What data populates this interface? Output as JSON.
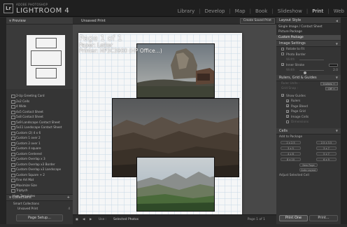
{
  "app": {
    "brand_small": "ADOBE PHOTOSHOP",
    "brand": "LIGHTROOM 4",
    "logo": "Lr"
  },
  "modules": [
    "Library",
    "Develop",
    "Map",
    "Book",
    "Slideshow",
    "Print",
    "Web"
  ],
  "active_module": "Print",
  "left_panel": {
    "preview_title": "Preview",
    "templates": [
      "2-Up Greeting Card",
      "2x2 Cells",
      "4 Wide",
      "4x5 Contact Sheet",
      "5x8 Contact Sheet",
      "5x9 Landscape Contact Sheet",
      "5x11 Landscape Contact Sheet",
      "Custom (2) 4 x 6",
      "Custom 1 over 2",
      "Custom 2 over 1",
      "Custom 4 square",
      "Custom Centered",
      "Custom Overlap x 3",
      "Custom Overlap x3 Border",
      "Custom Overlap x3 Landscape",
      "Custom Square + 2",
      "Fine Art Mat",
      "Maximize Size",
      "Triptych"
    ],
    "user_templates": "User Templates",
    "collections_title": "Collections",
    "collections": [
      {
        "name": "Smart Collections",
        "count": ""
      },
      {
        "name": "Unsaved Print",
        "count": "4"
      }
    ],
    "page_setup_label": "Page Setup..."
  },
  "center": {
    "title": "Unsaved Print",
    "create_saved_label": "Create Saved Print",
    "page_info": {
      "page": "Page 1 of 1",
      "paper": "Paper: Letter",
      "printer": "Printer: HP3C3900 (HP Office...)"
    },
    "footer": {
      "use_label": "Use :",
      "use_value": "Selected Photos",
      "page_count": "Page 1 of 1"
    }
  },
  "right_panel": {
    "layout_style_title": "Layout Style",
    "layout_styles": [
      "Single Image / Contact Sheet",
      "Picture Package",
      "Custom Package"
    ],
    "selected_style": "Custom Package",
    "image_settings_title": "Image Settings",
    "rotate_to_fit": "Rotate to Fit",
    "photo_border": "Photo Border",
    "width_label": "Width",
    "inner_stroke": "Inner Stroke",
    "inner_stroke_width": "2.0",
    "rulers_title": "Rulers, Grid & Guides",
    "ruler_units_label": "Ruler Units :",
    "ruler_units_value": "Inches ÷",
    "grid_snap_label": "Grid Snap :",
    "grid_snap_value": "Off ÷",
    "show_guides": "Show Guides",
    "guides": [
      {
        "label": "Rulers",
        "checked": true
      },
      {
        "label": "Page Bleed",
        "checked": true
      },
      {
        "label": "Page Grid",
        "checked": true
      },
      {
        "label": "Image Cells",
        "checked": true
      },
      {
        "label": "Dimensions",
        "checked": false
      }
    ],
    "cells_title": "Cells",
    "add_to_package": "Add to Package",
    "package_sizes": [
      "2 x 2.5",
      "2.5 x 3.5",
      "3 x 5",
      "3 x 7",
      "4 x 6",
      "5 x 7",
      "8 x 10",
      "6 x 9"
    ],
    "new_page": "New Page",
    "auto_layout": "Auto Layout",
    "adjust_cell": "Adjust Selected Cell",
    "print_one": "Print One",
    "print": "Print..."
  }
}
